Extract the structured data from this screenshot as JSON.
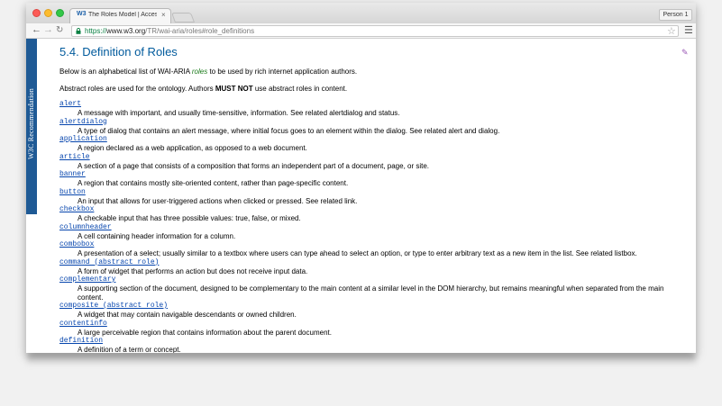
{
  "browser": {
    "tab_favicon": "W3",
    "tab_title": "The Roles Model | Accessi",
    "tab_close": "×",
    "profile": "Person 1",
    "url_scheme": "https://",
    "url_host": "www.w3.org",
    "url_path": "/TR/wai-aria/roles#role_definitions",
    "icons": [
      "back-arrow-icon",
      "forward-arrow-icon",
      "reload-icon",
      "lock-icon",
      "star-icon",
      "menu-icon"
    ]
  },
  "sidebar": {
    "label": "W3C Recommendation",
    "color": "#1f5a95"
  },
  "section": {
    "title": "5.4. Definition of Roles",
    "intro_before": "Below is an alphabetical list of WAI-ARIA ",
    "intro_em": "roles",
    "intro_after": " to be used by rich internet application authors.",
    "abstract_before": "Abstract roles are used for the ontology. Authors ",
    "abstract_strong": "MUST NOT",
    "abstract_after": " use abstract roles in content."
  },
  "roles": [
    {
      "term": "alert",
      "desc": "A message with important, and usually time-sensitive, information. See related alertdialog and status."
    },
    {
      "term": "alertdialog",
      "desc": "A type of dialog that contains an alert message, where initial focus goes to an element within the dialog. See related alert and dialog."
    },
    {
      "term": "application",
      "desc": "A region declared as a web application, as opposed to a web document."
    },
    {
      "term": "article",
      "desc": "A section of a page that consists of a composition that forms an independent part of a document, page, or site."
    },
    {
      "term": "banner",
      "desc": "A region that contains mostly site-oriented content, rather than page-specific content."
    },
    {
      "term": "button",
      "desc": "An input that allows for user-triggered actions when clicked or pressed. See related link."
    },
    {
      "term": "checkbox",
      "desc": "A checkable input that has three possible values: true, false, or mixed."
    },
    {
      "term": "columnheader",
      "desc": "A cell containing header information for a column."
    },
    {
      "term": "combobox",
      "desc": "A presentation of a select; usually similar to a textbox where users can type ahead to select an option, or type to enter arbitrary text as a new item in the list. See related listbox."
    },
    {
      "term": "command (abstract role)",
      "desc": "A form of widget that performs an action but does not receive input data."
    },
    {
      "term": "complementary",
      "desc": "A supporting section of the document, designed to be complementary to the main content at a similar level in the DOM hierarchy, but remains meaningful when separated from the main content."
    },
    {
      "term": "composite (abstract role)",
      "desc": "A widget that may contain navigable descendants or owned children."
    },
    {
      "term": "contentinfo",
      "desc": "A large perceivable region that contains information about the parent document."
    },
    {
      "term": "definition",
      "desc": "A definition of a term or concept."
    }
  ]
}
